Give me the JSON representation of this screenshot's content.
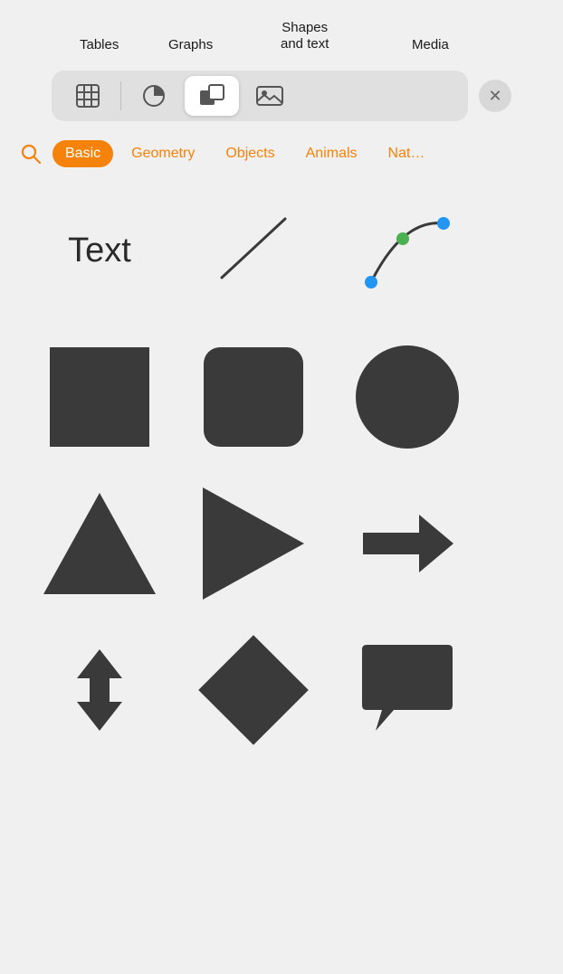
{
  "labels": {
    "tables": "Tables",
    "graphs": "Graphs",
    "shapes_and_text": "Shapes\nand text",
    "media": "Media"
  },
  "toolbar": {
    "tabs": [
      {
        "id": "tables",
        "label": "Tables",
        "active": false
      },
      {
        "id": "graphs",
        "label": "Graphs",
        "active": false
      },
      {
        "id": "shapes",
        "label": "Shapes and text",
        "active": true
      },
      {
        "id": "media",
        "label": "Media",
        "active": false
      }
    ],
    "close_label": "×"
  },
  "categories": {
    "search_placeholder": "Search",
    "items": [
      {
        "id": "basic",
        "label": "Basic",
        "active": true
      },
      {
        "id": "geometry",
        "label": "Geometry",
        "active": false
      },
      {
        "id": "objects",
        "label": "Objects",
        "active": false
      },
      {
        "id": "animals",
        "label": "Animals",
        "active": false
      },
      {
        "id": "nature",
        "label": "Nat…",
        "active": false
      }
    ]
  },
  "shapes": {
    "rows": [
      [
        {
          "id": "text",
          "type": "text",
          "label": "Text"
        },
        {
          "id": "line",
          "type": "line",
          "label": "Line"
        },
        {
          "id": "curve",
          "type": "curve",
          "label": "Curve"
        }
      ],
      [
        {
          "id": "rect",
          "type": "rect",
          "label": "Rectangle"
        },
        {
          "id": "rounded-rect",
          "type": "rounded-rect",
          "label": "Rounded Rectangle"
        },
        {
          "id": "circle",
          "type": "circle",
          "label": "Circle"
        }
      ],
      [
        {
          "id": "triangle-up",
          "type": "triangle-up",
          "label": "Triangle"
        },
        {
          "id": "triangle-right",
          "type": "triangle-right",
          "label": "Right Triangle"
        },
        {
          "id": "arrow-right",
          "type": "arrow-right",
          "label": "Arrow"
        }
      ],
      [
        {
          "id": "double-arrow",
          "type": "double-arrow",
          "label": "Double Arrow"
        },
        {
          "id": "diamond",
          "type": "diamond",
          "label": "Diamond"
        },
        {
          "id": "speech-bubble",
          "type": "speech-bubble",
          "label": "Speech Bubble"
        }
      ]
    ]
  },
  "colors": {
    "active_tab_bg": "#ffffff",
    "toolbar_bg": "#e0e0e0",
    "shape_fill": "#3a3a3a",
    "accent": "#f5820a",
    "close_bg": "#d8d8d8",
    "body_bg": "#f0f0f0"
  }
}
